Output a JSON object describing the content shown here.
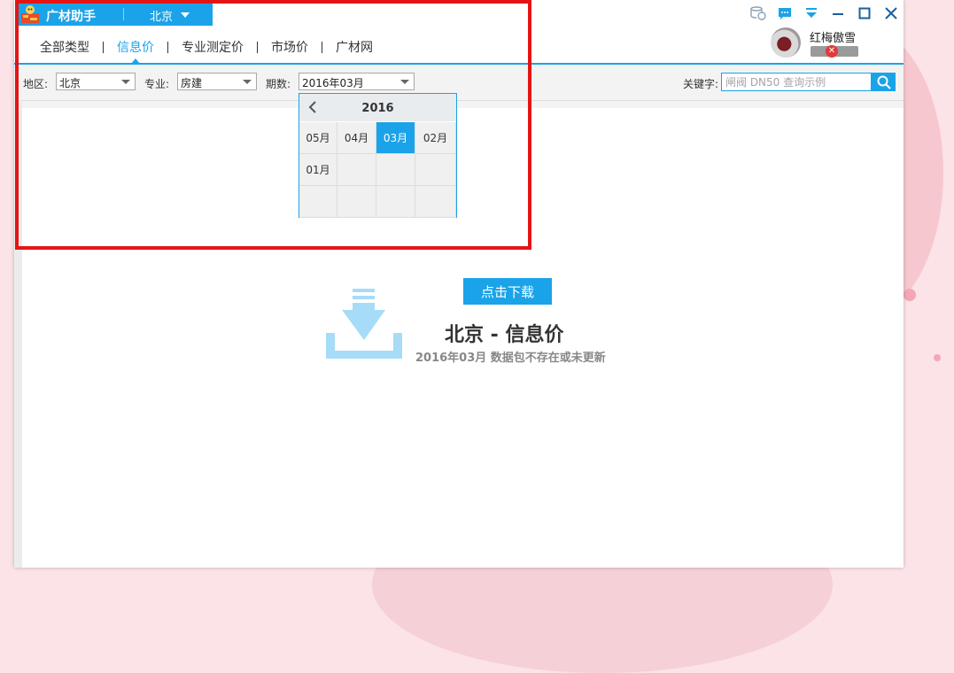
{
  "app": {
    "name": "广材助手",
    "city": "北京"
  },
  "nav": {
    "items": [
      "全部类型",
      "信息价",
      "专业测定价",
      "市场价",
      "广材网"
    ],
    "active_index": 1
  },
  "user": {
    "name": "红梅傲雪"
  },
  "filters": {
    "region_label": "地区:",
    "region_value": "北京",
    "specialty_label": "专业:",
    "specialty_value": "房建",
    "period_label": "期数:",
    "period_value": "2016年03月",
    "keyword_label": "关键字:",
    "keyword_placeholder": "闸阀 DN50 查询示例"
  },
  "picker": {
    "year": "2016",
    "months": [
      "05月",
      "04月",
      "03月",
      "02月",
      "01月",
      "",
      "",
      "",
      "",
      "",
      "",
      ""
    ],
    "selected": "03月"
  },
  "empty_state": {
    "download_label": "点击下载",
    "title": "北京 - 信息价",
    "subtitle": "2016年03月 数据包不存在或未更新"
  },
  "colors": {
    "accent": "#1aa3e8",
    "highlight": "#e51414"
  }
}
